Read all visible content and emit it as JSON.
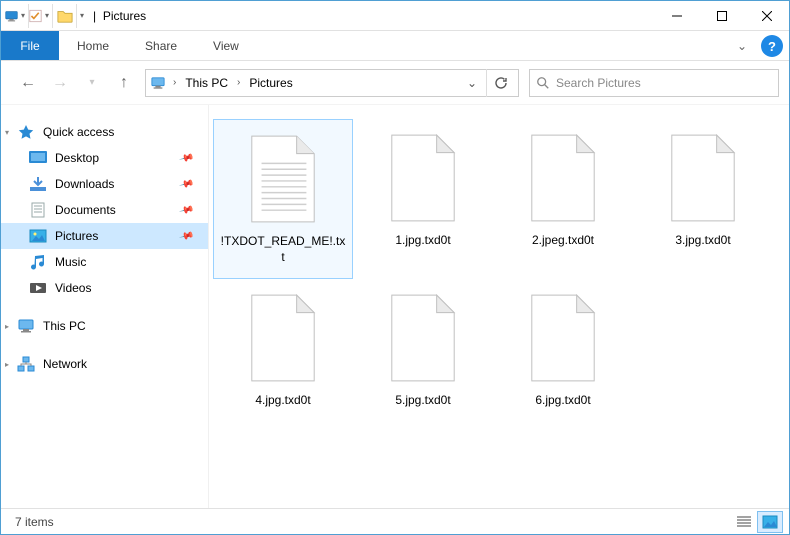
{
  "titlebar": {
    "title": "Pictures",
    "separator": "|"
  },
  "ribbon": {
    "file": "File",
    "tabs": [
      "Home",
      "Share",
      "View"
    ]
  },
  "breadcrumb": {
    "segments": [
      "This PC",
      "Pictures"
    ]
  },
  "search": {
    "placeholder": "Search Pictures"
  },
  "nav": {
    "quick_access": {
      "label": "Quick access",
      "items": [
        {
          "label": "Desktop",
          "icon": "desktop",
          "pinned": true
        },
        {
          "label": "Downloads",
          "icon": "downloads",
          "pinned": true
        },
        {
          "label": "Documents",
          "icon": "documents",
          "pinned": true
        },
        {
          "label": "Pictures",
          "icon": "pictures",
          "pinned": true,
          "selected": true
        },
        {
          "label": "Music",
          "icon": "music",
          "pinned": false
        },
        {
          "label": "Videos",
          "icon": "videos",
          "pinned": false
        }
      ]
    },
    "this_pc": {
      "label": "This PC"
    },
    "network": {
      "label": "Network"
    }
  },
  "files": [
    {
      "name": "!TXDOT_READ_ME!.txt",
      "icon": "textfile",
      "selected": true
    },
    {
      "name": "1.jpg.txd0t",
      "icon": "blankfile"
    },
    {
      "name": "2.jpeg.txd0t",
      "icon": "blankfile"
    },
    {
      "name": "3.jpg.txd0t",
      "icon": "blankfile"
    },
    {
      "name": "4.jpg.txd0t",
      "icon": "blankfile"
    },
    {
      "name": "5.jpg.txd0t",
      "icon": "blankfile"
    },
    {
      "name": "6.jpg.txd0t",
      "icon": "blankfile"
    }
  ],
  "status": {
    "count_label": "7 items"
  }
}
